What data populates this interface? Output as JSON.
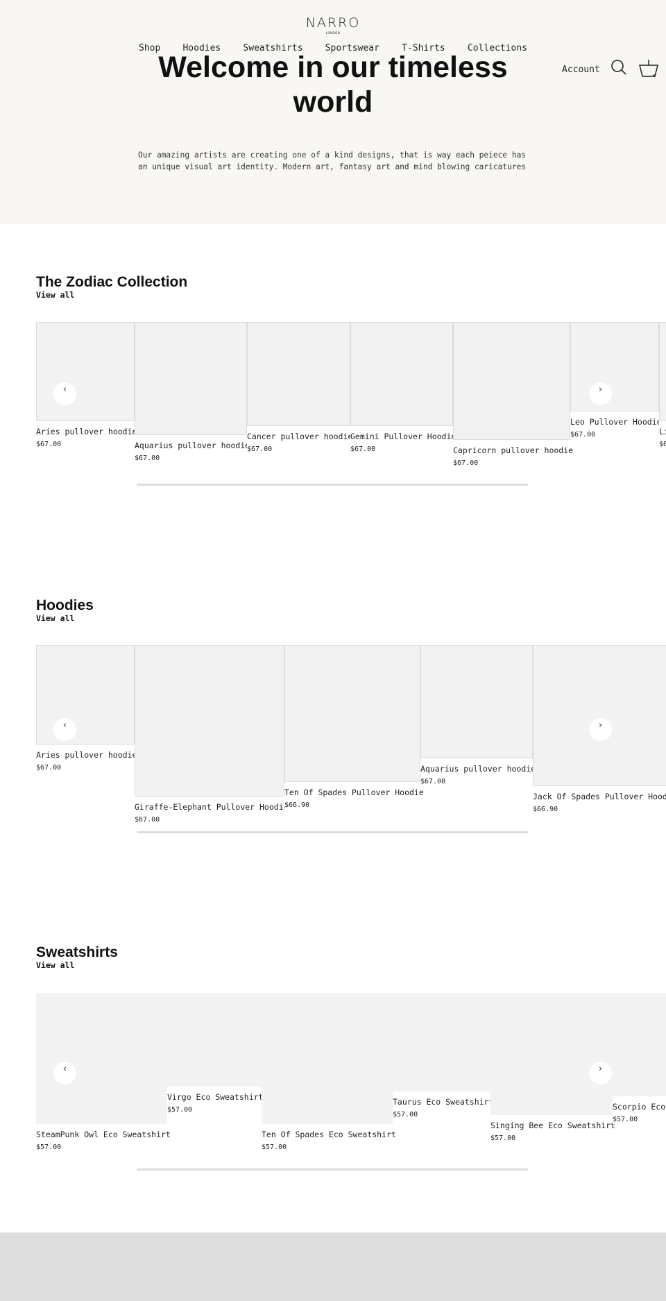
{
  "header": {
    "brand": "NARRO",
    "brand_sub": "LONDON",
    "nav": [
      "Shop",
      "Hoodies",
      "Sweatshirts",
      "Sportswear",
      "T-Shirts",
      "Collections"
    ],
    "account": "Account"
  },
  "hero": {
    "title": "Welcome in our timeless world",
    "text": "Our amazing artists are creating one of a kind designs, that is way each peiece has\nan unique visual art identity. Modern art, fantasy art and mind blowing caricatures"
  },
  "zodiac": {
    "title": "The Zodiac Collection",
    "view_all": "View all",
    "products": [
      {
        "name": "Aries pullover hoodie",
        "price": "$67.00"
      },
      {
        "name": "Aquarius pullover hoodie",
        "price": "$67.00"
      },
      {
        "name": "Cancer pullover hoodie",
        "price": "$67.00"
      },
      {
        "name": "Gemini Pullover Hoodie",
        "price": "$67.00"
      },
      {
        "name": "Capricorn pullover hoodie",
        "price": "$67.00"
      },
      {
        "name": "Leo Pullover Hoodie",
        "price": "$67.00"
      },
      {
        "name": "Li",
        "price": "$6"
      }
    ]
  },
  "hoodies": {
    "title": "Hoodies",
    "view_all": "View all",
    "products": [
      {
        "name": "Aries pullover hoodie",
        "price": "$67.00"
      },
      {
        "name": "Giraffe-Elephant Pullover Hoodie",
        "price": "$67.00"
      },
      {
        "name": "Ten Of Spades Pullover Hoodie",
        "price": "$66.90"
      },
      {
        "name": "Aquarius pullover hoodie",
        "price": "$67.00"
      },
      {
        "name": "Jack Of Spades Pullover Hoodie",
        "price": "$66.90"
      }
    ]
  },
  "sweatshirts": {
    "title": "Sweatshirts",
    "view_all": "View all",
    "products": [
      {
        "name": "SteamPunk Owl Eco Sweatshirt",
        "price": "$57.00"
      },
      {
        "name": "Virgo Eco Sweatshirt",
        "price": "$57.00"
      },
      {
        "name": "Ten Of Spades Eco Sweatshirt",
        "price": "$57.00"
      },
      {
        "name": "Taurus Eco Sweatshirt",
        "price": "$57.00"
      },
      {
        "name": "Singing Bee Eco Sweatshirt",
        "price": "$57.00"
      },
      {
        "name": "Scorpio Eco Sweatshirt",
        "price": "$57.00"
      }
    ]
  },
  "icons": {
    "prev": "‹",
    "next": "›"
  }
}
